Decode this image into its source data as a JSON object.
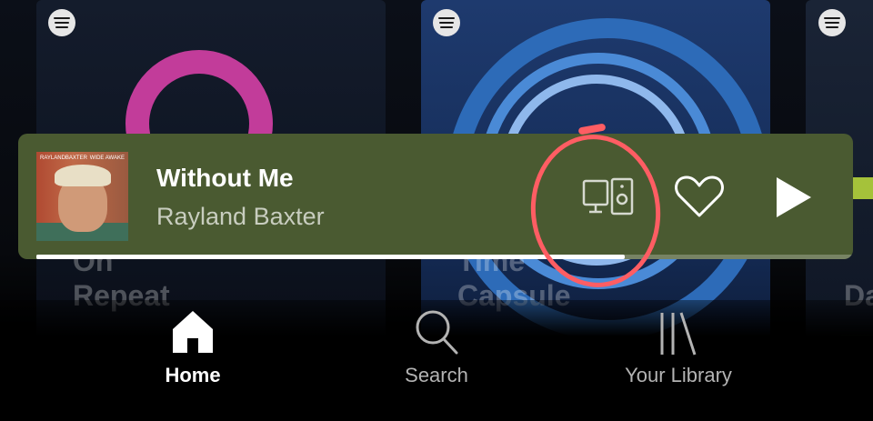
{
  "player": {
    "track_title": "Without Me",
    "artist": "Rayland Baxter",
    "progress": 0.72,
    "icons": [
      "connect-devices-icon",
      "heart-icon",
      "play-icon"
    ],
    "background_color": "#4a5a31"
  },
  "cover_art": {
    "caption_left": "RAYLANDBAXTER",
    "caption_right": "WIDE AWAKE"
  },
  "cards": [
    {
      "title_line1": "On",
      "title_line2": "Repeat"
    },
    {
      "title_line1": "Time",
      "title_line2": "Capsule"
    },
    {
      "title_line1": "Da"
    }
  ],
  "annotation": {
    "color": "#ff5d63",
    "target": "connect-devices-icon"
  },
  "nav": {
    "items": [
      {
        "label": "Home",
        "icon": "home-icon",
        "active": true
      },
      {
        "label": "Search",
        "icon": "search-icon",
        "active": false
      },
      {
        "label": "Your Library",
        "icon": "library-icon",
        "active": false
      }
    ]
  }
}
